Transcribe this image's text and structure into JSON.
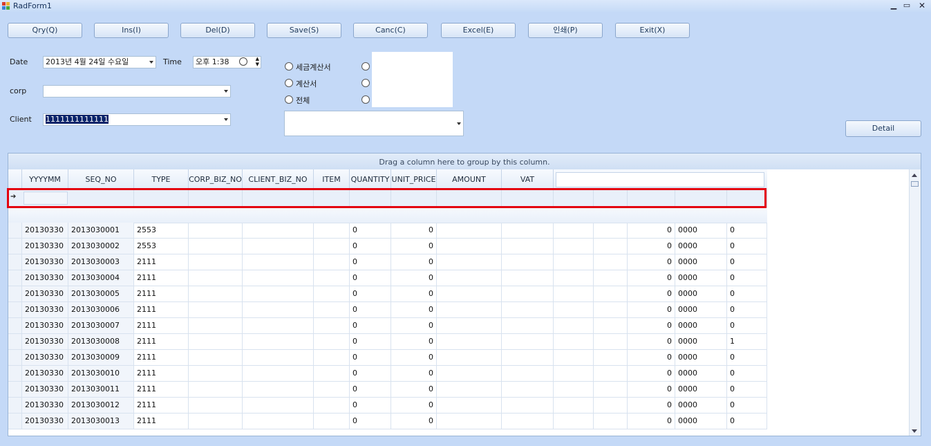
{
  "window": {
    "title": "RadForm1"
  },
  "toolbar": {
    "buttons": [
      {
        "label": "Qry(Q)"
      },
      {
        "label": "Ins(I)"
      },
      {
        "label": "Del(D)"
      },
      {
        "label": "Save(S)"
      },
      {
        "label": "Canc(C)"
      },
      {
        "label": "Excel(E)"
      },
      {
        "label": "인쇄(P)"
      },
      {
        "label": "Exit(X)"
      }
    ]
  },
  "form": {
    "date_label": "Date",
    "date_value": "2013년 4월 24일 수요일",
    "time_label": "Time",
    "time_value": "오후 1:38",
    "corp_label": "corp",
    "corp_value": "",
    "client_label": "Client",
    "client_value": "1111111111111",
    "radio_options": [
      "세금계산서",
      "계산서",
      "전체"
    ],
    "detail_label": "Detail"
  },
  "grid": {
    "group_panel_text": "Drag a column here to group by this column.",
    "columns": [
      "YYYYMM",
      "SEQ_NO",
      "TYPE",
      "CORP_BIZ_NO",
      "CLIENT_BIZ_NO",
      "ITEM",
      "QUANTITY",
      "UNIT_PRICE",
      "AMOUNT",
      "VAT"
    ],
    "rows": [
      [
        "20130330",
        "2013030001",
        "2553",
        "",
        "",
        "",
        "0",
        "0",
        "",
        "",
        "",
        "",
        "0",
        "0000",
        "0"
      ],
      [
        "20130330",
        "2013030002",
        "2553",
        "",
        "",
        "",
        "0",
        "0",
        "",
        "",
        "",
        "",
        "0",
        "0000",
        "0"
      ],
      [
        "20130330",
        "2013030003",
        "2111",
        "",
        "",
        "",
        "0",
        "0",
        "",
        "",
        "",
        "",
        "0",
        "0000",
        "0"
      ],
      [
        "20130330",
        "2013030004",
        "2111",
        "",
        "",
        "",
        "0",
        "0",
        "",
        "",
        "",
        "",
        "0",
        "0000",
        "0"
      ],
      [
        "20130330",
        "2013030005",
        "2111",
        "",
        "",
        "",
        "0",
        "0",
        "",
        "",
        "",
        "",
        "0",
        "0000",
        "0"
      ],
      [
        "20130330",
        "2013030006",
        "2111",
        "",
        "",
        "",
        "0",
        "0",
        "",
        "",
        "",
        "",
        "0",
        "0000",
        "0"
      ],
      [
        "20130330",
        "2013030007",
        "2111",
        "",
        "",
        "",
        "0",
        "0",
        "",
        "",
        "",
        "",
        "0",
        "0000",
        "0"
      ],
      [
        "20130330",
        "2013030008",
        "2111",
        "",
        "",
        "",
        "0",
        "0",
        "",
        "",
        "",
        "",
        "0",
        "0000",
        "1"
      ],
      [
        "20130330",
        "2013030009",
        "2111",
        "",
        "",
        "",
        "0",
        "0",
        "",
        "",
        "",
        "",
        "0",
        "0000",
        "0"
      ],
      [
        "20130330",
        "2013030010",
        "2111",
        "",
        "",
        "",
        "0",
        "0",
        "",
        "",
        "",
        "",
        "0",
        "0000",
        "0"
      ],
      [
        "20130330",
        "2013030011",
        "2111",
        "",
        "",
        "",
        "0",
        "0",
        "",
        "",
        "",
        "",
        "0",
        "0000",
        "0"
      ],
      [
        "20130330",
        "2013030012",
        "2111",
        "",
        "",
        "",
        "0",
        "0",
        "",
        "",
        "",
        "",
        "0",
        "0000",
        "0"
      ],
      [
        "20130330",
        "2013030013",
        "2111",
        "",
        "",
        "",
        "0",
        "0",
        "",
        "",
        "",
        "",
        "0",
        "0000",
        "0"
      ]
    ]
  }
}
